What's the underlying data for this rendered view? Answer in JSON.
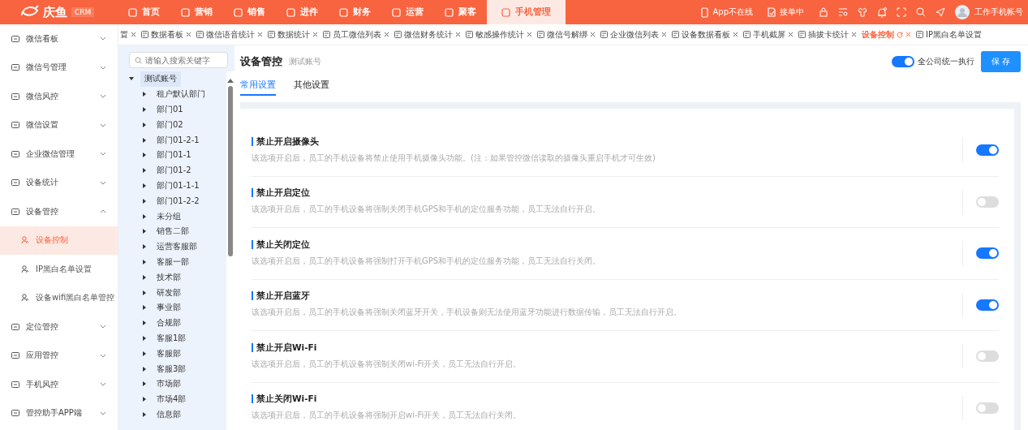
{
  "header": {
    "logo": "庆鱼",
    "badge": "CRM",
    "nav": [
      {
        "label": "首页",
        "selected": false
      },
      {
        "label": "营销",
        "selected": false
      },
      {
        "label": "销售",
        "selected": false
      },
      {
        "label": "进件",
        "selected": false
      },
      {
        "label": "财务",
        "selected": false
      },
      {
        "label": "运营",
        "selected": false
      },
      {
        "label": "聚客",
        "selected": false
      },
      {
        "label": "手机管理",
        "selected": true
      }
    ],
    "app_status": "App不在线",
    "order_status": "接单中",
    "user": "工作手机帐号"
  },
  "sidebar": {
    "items": [
      {
        "label": "微信看板",
        "expanded": false
      },
      {
        "label": "微信号管理",
        "expanded": false
      },
      {
        "label": "微信风控",
        "expanded": false
      },
      {
        "label": "微信设置",
        "expanded": false
      },
      {
        "label": "企业微信管理",
        "expanded": false
      },
      {
        "label": "设备统计",
        "expanded": false
      },
      {
        "label": "设备管控",
        "expanded": true,
        "children": [
          {
            "label": "设备控制",
            "selected": true
          },
          {
            "label": "IP黑白名单设置",
            "selected": false
          },
          {
            "label": "设备wifi黑白名单管控",
            "selected": false
          }
        ]
      },
      {
        "label": "定位管控",
        "expanded": false
      },
      {
        "label": "应用管控",
        "expanded": false
      },
      {
        "label": "手机风控",
        "expanded": false
      },
      {
        "label": "管控助手APP端",
        "expanded": false
      }
    ]
  },
  "tabs": [
    {
      "label": "置",
      "selected": false,
      "closable": true
    },
    {
      "label": "数据看板",
      "selected": false,
      "closable": true
    },
    {
      "label": "微信语音统计",
      "selected": false,
      "closable": true
    },
    {
      "label": "数据统计",
      "selected": false,
      "closable": true
    },
    {
      "label": "员工微信列表",
      "selected": false,
      "closable": true
    },
    {
      "label": "微信财务统计",
      "selected": false,
      "closable": true
    },
    {
      "label": "敏感操作统计",
      "selected": false,
      "closable": true
    },
    {
      "label": "微信号解绑",
      "selected": false,
      "closable": true
    },
    {
      "label": "企业微信列表",
      "selected": false,
      "closable": true
    },
    {
      "label": "设备数据看板",
      "selected": false,
      "closable": true
    },
    {
      "label": "手机截屏",
      "selected": false,
      "closable": true
    },
    {
      "label": "插拔卡统计",
      "selected": false,
      "closable": true
    },
    {
      "label": "设备控制",
      "selected": true,
      "closable": true
    },
    {
      "label": "IP黑白名单设置",
      "selected": false,
      "closable": false
    }
  ],
  "tree": {
    "search": {
      "placeholder": "请输入搜索关键字"
    },
    "root": {
      "label": "测试账号",
      "expanded": true,
      "children": [
        {
          "label": "租户默认部门",
          "expanded": false
        },
        {
          "label": "部门01",
          "expanded": false
        },
        {
          "label": "部门02",
          "expanded": false
        },
        {
          "label": "部门01-2-1",
          "expanded": false
        },
        {
          "label": "部门01-1",
          "expanded": false
        },
        {
          "label": "部门01-2",
          "expanded": false
        },
        {
          "label": "部门01-1-1",
          "expanded": false
        },
        {
          "label": "部门01-2-2",
          "expanded": false
        },
        {
          "label": "未分组",
          "expanded": false
        },
        {
          "label": "销售二部",
          "expanded": false
        },
        {
          "label": "运营客服部",
          "expanded": false
        },
        {
          "label": "客服一部",
          "expanded": false
        },
        {
          "label": "技术部",
          "expanded": false
        },
        {
          "label": "研发部",
          "expanded": false
        },
        {
          "label": "事业部",
          "expanded": false
        },
        {
          "label": "合规部",
          "expanded": false
        },
        {
          "label": "客服1部",
          "expanded": false
        },
        {
          "label": "客服部",
          "expanded": false
        },
        {
          "label": "客服3部",
          "expanded": false
        },
        {
          "label": "市场部",
          "expanded": false
        },
        {
          "label": "市场4部",
          "expanded": false
        },
        {
          "label": "信息部",
          "expanded": false
        }
      ]
    }
  },
  "page": {
    "title": "设备管控",
    "subtitle": "测试账号",
    "tabs": [
      {
        "label": "常用设置",
        "selected": true
      },
      {
        "label": "其他设置",
        "selected": false
      }
    ],
    "company_switch": {
      "label": "全公司统一执行",
      "on": true
    },
    "save": "保 存",
    "settings": [
      {
        "title": "禁止开启摄像头",
        "description": "该选项开启后，员工的手机设备将禁止使用手机摄像头功能。(注：如果管控微信读取的摄像头重启手机才可生效)",
        "on": true
      },
      {
        "title": "禁止开启定位",
        "description": "该选项开启后，员工的手机设备将强制关闭手机GPS和手机的定位服务功能，员工无法自行开启。",
        "on": false
      },
      {
        "title": "禁止关闭定位",
        "description": "该选项开启后，员工的手机设备将强制打开手机GPS和手机的定位服务功能，员工无法自行关闭。",
        "on": true
      },
      {
        "title": "禁止开启蓝牙",
        "description": "该选项开启后，员工的手机设备将强制关闭蓝牙开关，手机设备则无法使用蓝牙功能进行数据传输，员工无法自行开启。",
        "on": true
      },
      {
        "title": "禁止开启Wi-Fi",
        "description": "该选项开启后，员工的手机设备将强制关闭wi-Fi开关，员工无法自行开启。",
        "on": false
      },
      {
        "title": "禁止关闭Wi-Fi",
        "description": "该选项开启后，员工的手机设备将强制开启wi-Fi开关，员工无法自行关闭。",
        "on": false
      }
    ]
  }
}
